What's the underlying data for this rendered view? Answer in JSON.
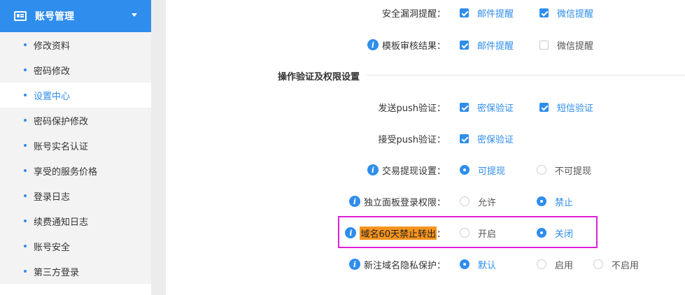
{
  "sidebar": {
    "header": {
      "title": "账号管理",
      "icon": "account-card-icon",
      "caret": "caret-down-icon"
    },
    "items": [
      {
        "label": "修改资料"
      },
      {
        "label": "密码修改"
      },
      {
        "label": "设置中心",
        "active": true
      },
      {
        "label": "密码保护修改"
      },
      {
        "label": "账号实名认证"
      },
      {
        "label": "享受的服务价格"
      },
      {
        "label": "登录日志"
      },
      {
        "label": "续费通知日志"
      },
      {
        "label": "账号安全"
      },
      {
        "label": "第三方登录"
      }
    ]
  },
  "settings": {
    "vuln_alert": {
      "label": "安全漏洞提醒：",
      "options": [
        {
          "label": "邮件提醒",
          "checked": true
        },
        {
          "label": "微信提醒",
          "checked": true
        }
      ]
    },
    "template_review": {
      "label": "模板审核结果：",
      "options": [
        {
          "label": "邮件提醒",
          "checked": true
        },
        {
          "label": "微信提醒",
          "checked": false
        }
      ]
    },
    "section_title": "操作验证及权限设置",
    "send_push": {
      "label": "发送push验证：",
      "options": [
        {
          "label": "密保验证",
          "checked": true
        },
        {
          "label": "短信验证",
          "checked": true
        }
      ]
    },
    "receive_push": {
      "label": "接受push验证：",
      "options": [
        {
          "label": "密保验证",
          "checked": true
        }
      ]
    },
    "withdraw": {
      "label": "交易提现设置：",
      "options": [
        {
          "label": "可提现",
          "selected": true
        },
        {
          "label": "不可提现",
          "selected": false
        }
      ]
    },
    "panel_login": {
      "label": "独立面板登录权限：",
      "options": [
        {
          "label": "允许",
          "selected": false
        },
        {
          "label": "禁止",
          "selected": true
        }
      ]
    },
    "domain_transfer": {
      "label_text": "域名60天禁止转出",
      "colon": "：",
      "options": [
        {
          "label": "开启",
          "selected": false
        },
        {
          "label": "关闭",
          "selected": true
        }
      ]
    },
    "privacy": {
      "label": "新注域名隐私保护：",
      "options": [
        {
          "label": "默认",
          "selected": true
        },
        {
          "label": "启用",
          "selected": false
        },
        {
          "label": "不启用",
          "selected": false
        }
      ]
    }
  },
  "colors": {
    "accent": "#2e8ded",
    "highlight": "#f7941d",
    "annotation_box": "#e020d6"
  }
}
